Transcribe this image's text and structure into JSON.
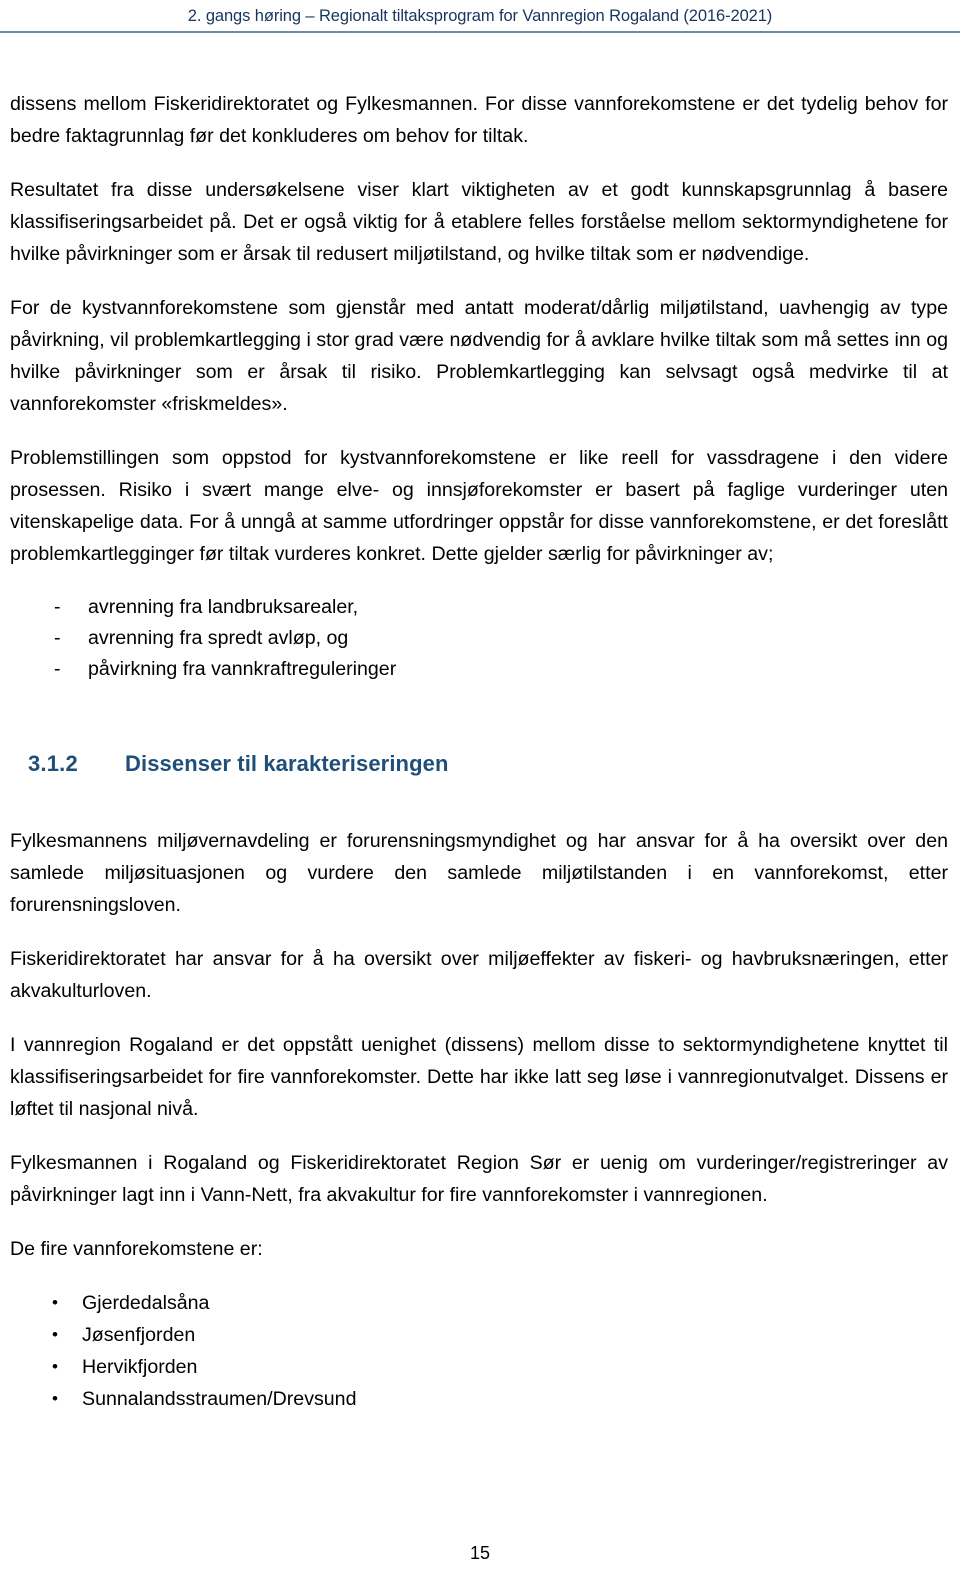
{
  "header": {
    "title": "2. gangs høring – Regionalt tiltaksprogram for Vannregion Rogaland (2016-2021)",
    "rule_color": "#6f8ca0",
    "title_color": "#17365d"
  },
  "body": {
    "paragraphs_top": [
      "dissens mellom Fiskeridirektoratet og Fylkesmannen. For disse vannforekomstene er det tydelig behov for bedre faktagrunnlag før det konkluderes om behov for tiltak.",
      "Resultatet fra disse undersøkelsene viser klart viktigheten av et godt kunnskapsgrunnlag å basere klassifiseringsarbeidet på. Det er også viktig for å etablere felles forståelse mellom sektormyndighetene for hvilke påvirkninger som er årsak til redusert miljøtilstand, og hvilke tiltak som er nødvendige.",
      "For de kystvannforekomstene som gjenstår med antatt moderat/dårlig miljøtilstand, uavhengig av type påvirkning, vil problemkartlegging i stor grad være nødvendig for å avklare hvilke tiltak som må settes inn og hvilke påvirkninger som er årsak til risiko. Problemkartlegging kan selvsagt også medvirke til at vannforekomster «friskmeldes».",
      "Problemstillingen som oppstod for kystvannforekomstene er like reell for vassdragene i den videre prosessen. Risiko i svært mange elve- og innsjøforekomster er basert på faglige vurderinger uten vitenskapelige data. For å unngå at samme utfordringer oppstår for disse vannforekomstene, er det foreslått problemkartlegginger før tiltak vurderes konkret. Dette gjelder særlig for påvirkninger av;"
    ],
    "dash_list": {
      "marker": "-",
      "items": [
        "avrenning fra landbruksarealer,",
        "avrenning fra spredt avløp, og",
        "påvirkning fra vannkraftreguleringer"
      ]
    },
    "heading": {
      "number": "3.1.2",
      "text": "Dissenser til karakteriseringen",
      "color": "#1f4e79"
    },
    "paragraphs_section": [
      "Fylkesmannens miljøvernavdeling er forurensningsmyndighet og har ansvar for å ha oversikt over den samlede miljøsituasjonen og vurdere den samlede miljøtilstanden i en vannforekomst, etter forurensningsloven.",
      "Fiskeridirektoratet har ansvar for å ha oversikt over miljøeffekter av fiskeri- og havbruksnæringen, etter akvakulturloven.",
      "I vannregion Rogaland er det oppstått uenighet (dissens) mellom disse to sektormyndighetene knyttet til klassifiseringsarbeidet for fire vannforekomster. Dette har ikke latt seg løse i vannregionutvalget. Dissens er løftet til nasjonal nivå.",
      "Fylkesmannen i Rogaland og Fiskeridirektoratet Region Sør er uenig om vurderinger/registreringer av påvirkninger lagt inn i Vann-Nett, fra akvakultur for fire vannforekomster i vannregionen.",
      "De fire vannforekomstene er:"
    ],
    "bullet_list": {
      "marker": "•",
      "items": [
        "Gjerdedalsåna",
        "Jøsenfjorden",
        "Hervikfjorden",
        "Sunnalandsstraumen/Drevsund"
      ]
    }
  },
  "footer": {
    "page_number": "15"
  }
}
